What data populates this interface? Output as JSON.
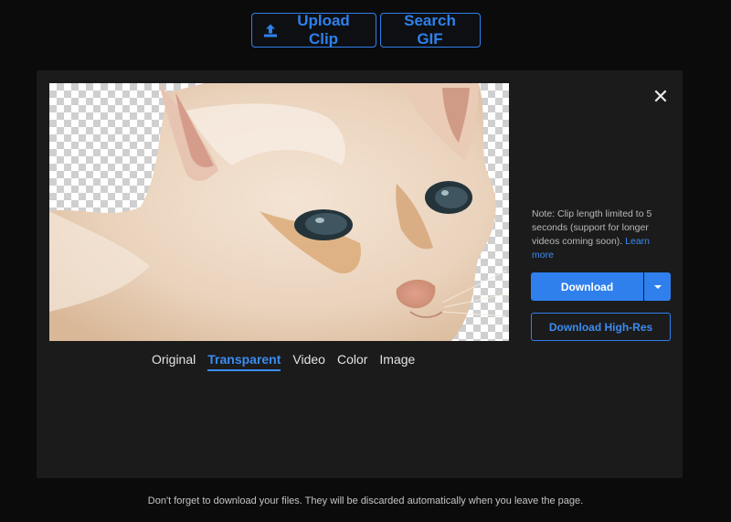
{
  "toolbar": {
    "upload_label": "Upload Clip",
    "search_label": "Search GIF",
    "upload_icon": "upload-icon"
  },
  "panel": {
    "close_icon": "close-icon",
    "preview_subject": "cat-cutout-image",
    "note_text": "Note: Clip length limited to 5 seconds (support for longer videos coming soon).",
    "note_link": "Learn more",
    "download_label": "Download",
    "download_hires_label": "Download High-Res",
    "tabs": [
      {
        "label": "Original",
        "active": false
      },
      {
        "label": "Transparent",
        "active": true
      },
      {
        "label": "Video",
        "active": false
      },
      {
        "label": "Color",
        "active": false
      },
      {
        "label": "Image",
        "active": false
      }
    ]
  },
  "footer": {
    "text": "Don't forget to download your files. They will be discarded automatically when you leave the page."
  },
  "colors": {
    "accent": "#2f80ed",
    "background": "#0b0b0c",
    "panel": "#1b1b1c"
  }
}
